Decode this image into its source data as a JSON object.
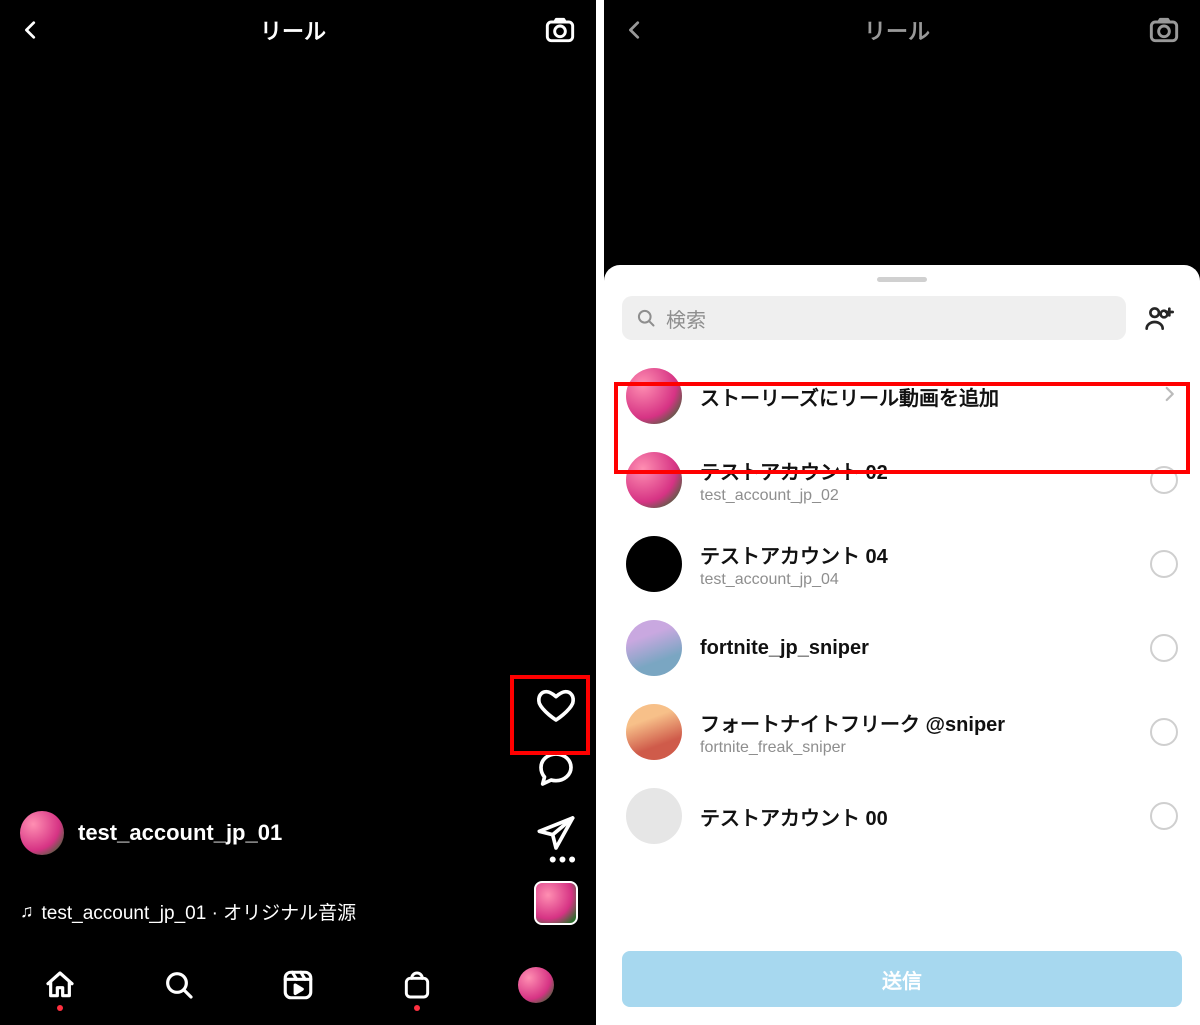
{
  "left": {
    "title": "リール",
    "username": "test_account_jp_01",
    "audio": "test_account_jp_01 · オリジナル音源"
  },
  "right": {
    "title": "リール",
    "search_placeholder": "検索",
    "add_to_story": "ストーリーズにリール動画を追加",
    "send": "送信",
    "contacts": [
      {
        "name": "テストアカウント 02",
        "sub": "test_account_jp_02",
        "avatar": "flowers"
      },
      {
        "name": "テストアカウント 04",
        "sub": "test_account_jp_04",
        "avatar": "dark"
      },
      {
        "name": "fortnite_jp_sniper",
        "sub": "",
        "avatar": "fort1"
      },
      {
        "name": "フォートナイトフリーク @sniper",
        "sub": "fortnite_freak_sniper",
        "avatar": "fort2"
      },
      {
        "name": "テストアカウント 00",
        "sub": "",
        "avatar": "grey"
      }
    ]
  }
}
